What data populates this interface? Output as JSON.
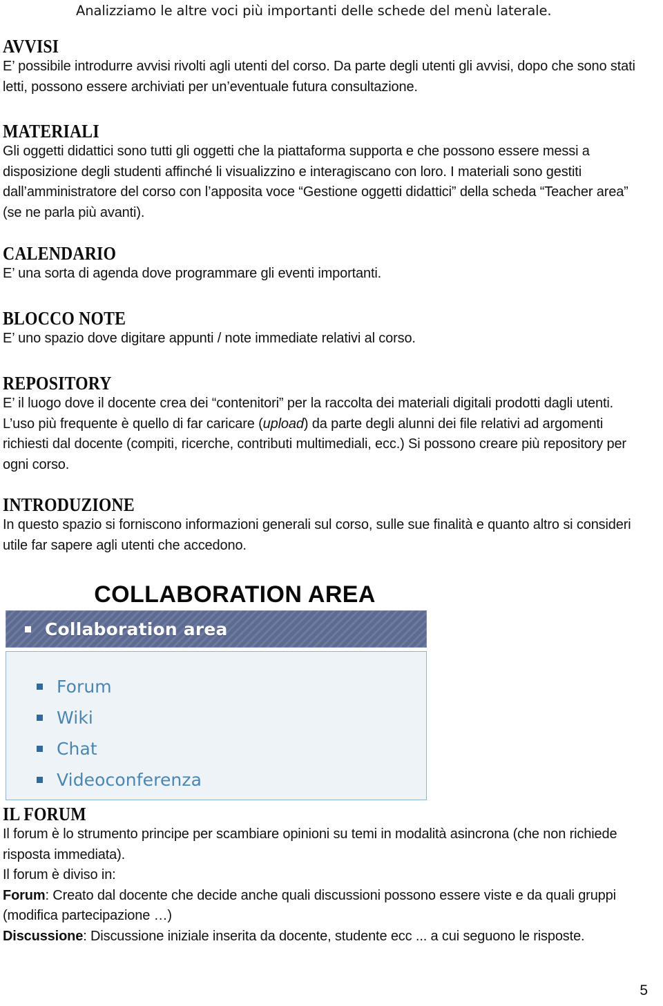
{
  "document": {
    "intro_line": "Analizziamo le altre voci più importanti delle schede del menù laterale.",
    "page_number": "5",
    "sections": [
      {
        "id": "avvisi",
        "heading": "AVVISI",
        "paragraph": "E’ possibile introdurre avvisi rivolti agli utenti del corso. Da parte degli utenti gli avvisi, dopo che sono stati letti, possono essere archiviati per un’eventuale futura consultazione."
      },
      {
        "id": "materiali",
        "heading": "MATERIALI",
        "paragraph": "Gli oggetti didattici sono tutti gli oggetti che la piattaforma supporta e che possono essere messi a disposizione degli studenti affinché li visualizzino e interagiscano con loro. I materiali sono gestiti dall’amministratore del corso con l’apposita voce “Gestione oggetti didattici” della scheda “Teacher area” (se ne parla più avanti)."
      },
      {
        "id": "calendario",
        "heading": "CALENDARIO",
        "paragraph": "E’ una sorta di agenda dove programmare gli eventi importanti."
      },
      {
        "id": "blocco-note",
        "heading": "BLOCCO NOTE",
        "paragraph": "E’ uno spazio dove digitare appunti / note immediate relativi al corso."
      },
      {
        "id": "repository",
        "heading": "REPOSITORY",
        "paragraph_part1": "E’ il luogo dove il docente crea dei “contenitori” per la raccolta dei materiali digitali prodotti dagli utenti. L’uso più frequente è quello di far caricare (",
        "paragraph_italic": "upload",
        "paragraph_part2": ") da parte degli alunni dei file relativi ad argomenti richiesti dal docente (compiti, ricerche, contributi multimediali, ecc.) Si possono creare più repository per ogni corso."
      },
      {
        "id": "introduzione",
        "heading": "INTRODUZIONE",
        "paragraph": "In questo spazio si forniscono informazioni generali sul corso, sulle sue finalità e quanto altro si consideri utile far sapere agli utenti che accedono."
      }
    ],
    "collaboration": {
      "title": "COLLABORATION AREA",
      "screenshot": {
        "header_label": "Collaboration area",
        "items": [
          {
            "label": "Forum"
          },
          {
            "label": "Wiki"
          },
          {
            "label": "Chat"
          },
          {
            "label": "Videoconferenza"
          }
        ]
      }
    },
    "forum_section": {
      "heading": "IL FORUM",
      "paragraph1": "Il forum è lo strumento principe per scambiare opinioni su temi in modalità asincrona (che non richiede risposta immediata).",
      "paragraph2": "Il forum è diviso in:",
      "forum_label": "Forum",
      "forum_text": ": Creato dal docente che decide anche quali discussioni possono essere viste e da quali gruppi (modifica partecipazione …)",
      "discussione_label": "Discussione",
      "discussione_text": ": Discussione iniziale inserita da docente, studente ecc ... a cui seguono le risposte."
    },
    "colors": {
      "screenshot_header_bg": "#5d6b93",
      "screenshot_body_bg": "#eef3f8",
      "screenshot_border": "#8ab5d3",
      "screenshot_link": "#4a86ae",
      "screenshot_bullet": "#31699c",
      "text": "#111111"
    }
  }
}
